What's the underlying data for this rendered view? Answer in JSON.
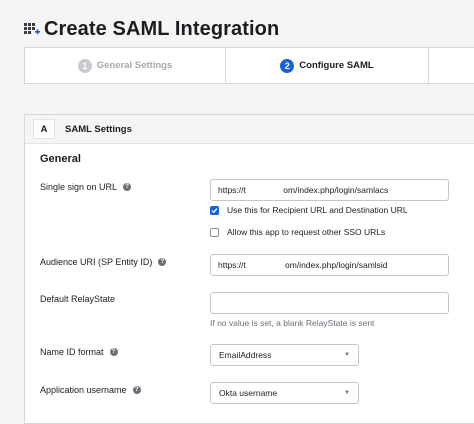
{
  "header": {
    "title": "Create SAML Integration",
    "icon": "app-grid-add-icon"
  },
  "steps": [
    {
      "number": "1",
      "label": "General Settings",
      "state": "inactive"
    },
    {
      "number": "2",
      "label": "Configure SAML",
      "state": "active"
    },
    {
      "number": "",
      "label": "",
      "state": "inactive"
    }
  ],
  "section": {
    "letter": "A",
    "title": "SAML Settings",
    "group_title": "General"
  },
  "fields": {
    "sso_url": {
      "label": "Single sign on URL",
      "value": "https://t                      om/index.php/login/samlacs"
    },
    "recipient_checkbox": {
      "label": "Use this for Recipient URL and Destination URL",
      "checked": true
    },
    "sso_checkbox": {
      "label": "Allow this app to request other SSO URLs",
      "checked": false
    },
    "audience_uri": {
      "label": "Audience URI (SP Entity ID)",
      "value": "https://t                       om/index.php/login/samlsid"
    },
    "relay_state": {
      "label": "Default RelayState",
      "value": "",
      "hint": "If no value is set, a blank RelayState is sent"
    },
    "name_id_format": {
      "label": "Name ID format",
      "value": "EmailAddress"
    },
    "app_username": {
      "label": "Application username",
      "value": "Okta username"
    }
  },
  "colors": {
    "accent": "#1662dd",
    "background": "#f5f5f6",
    "border": "#d7d7dc"
  }
}
